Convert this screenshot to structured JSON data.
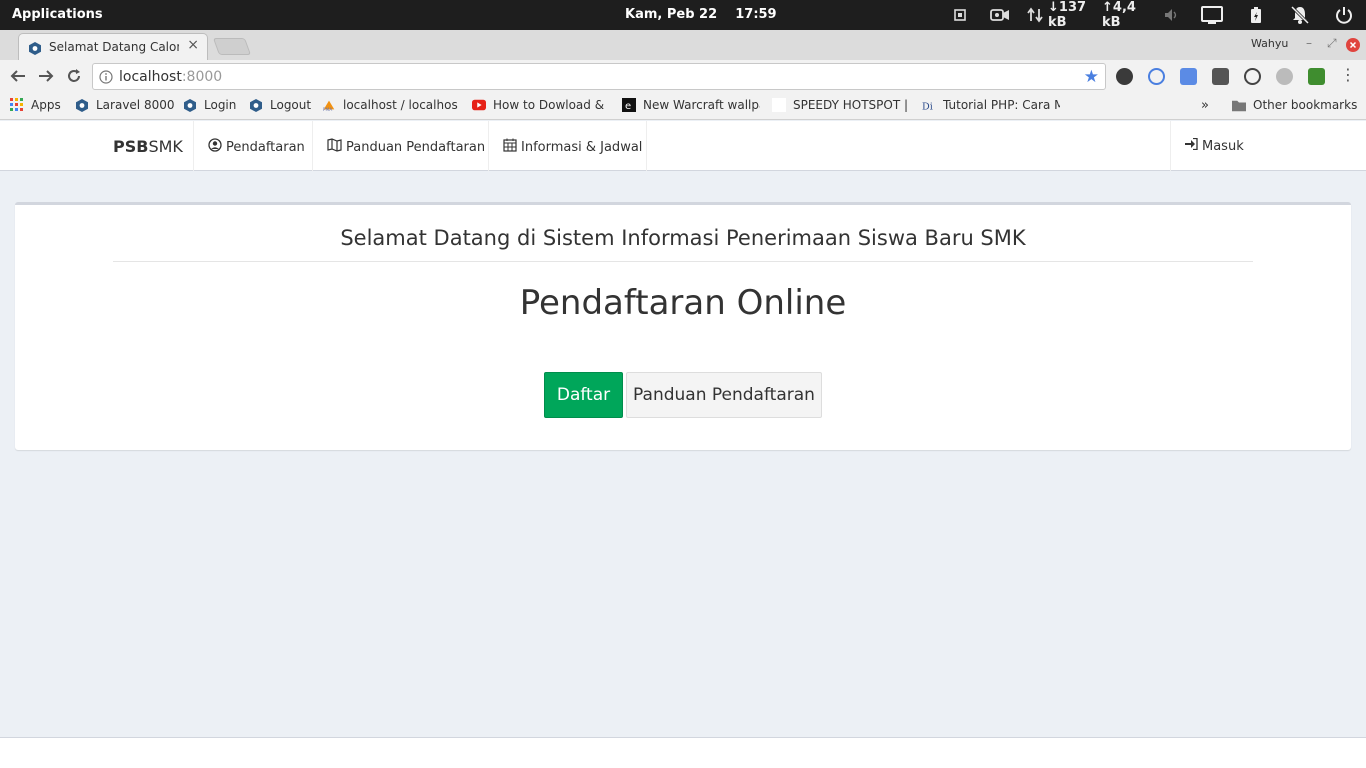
{
  "os": {
    "menu_label": "Applications",
    "clock": "Kam, Peb 22    17:59",
    "net_down": "↓137 kB",
    "net_up": "↑4,4 kB"
  },
  "browser": {
    "tab_title": "Selamat Datang Calon S",
    "profile_name": "Wahyu",
    "url_host": "localhost",
    "url_port": ":8000",
    "bookmarks": [
      {
        "label": "Apps",
        "icon": "apps-grid-icon"
      },
      {
        "label": "Laravel 8000",
        "icon": "laravel-icon"
      },
      {
        "label": "Login",
        "icon": "laravel-icon"
      },
      {
        "label": "Logout",
        "icon": "laravel-icon"
      },
      {
        "label": "localhost / localhost",
        "icon": "phpmyadmin-icon"
      },
      {
        "label": "How to Dowload & In",
        "icon": "youtube-icon"
      },
      {
        "label": "New Warcraft wallpa",
        "icon": "e-icon"
      },
      {
        "label": "SPEEDY HOTSPOT |",
        "icon": "blank-page-icon"
      },
      {
        "label": "Tutorial PHP: Cara M",
        "icon": "di-icon"
      }
    ],
    "other_bookmarks": "Other bookmarks",
    "more_bookmarks": "»"
  },
  "app": {
    "brand_bold": "PSB",
    "brand_rest": "SMK",
    "nav": [
      {
        "label": "Pendaftaran",
        "icon": "user-circle-icon"
      },
      {
        "label": "Panduan Pendaftaran",
        "icon": "map-icon"
      },
      {
        "label": "Informasi & Jadwal",
        "icon": "calendar-icon"
      }
    ],
    "login": "Masuk"
  },
  "content": {
    "welcome": "Selamat Datang di Sistem Informasi Penerimaan Siswa Baru SMK",
    "headline": "Pendaftaran Online",
    "primary_button": "Daftar",
    "secondary_button": "Panduan Pendaftaran"
  },
  "colors": {
    "success": "#00a65a",
    "page_bg": "#ecf0f5",
    "chrome_star": "#4a7fe0"
  }
}
